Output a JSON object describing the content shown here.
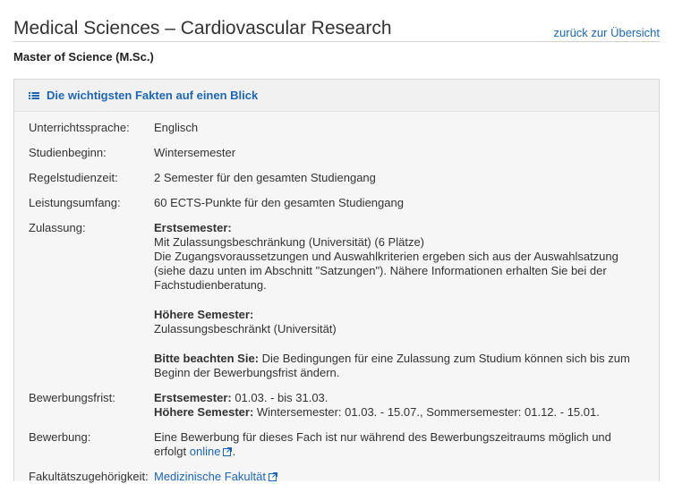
{
  "header": {
    "title": "Medical Sciences – Cardiovascular Research",
    "back_link": "zurück zur Übersicht",
    "degree": "Master of Science (M.Sc.)"
  },
  "panel": {
    "title": "Die wichtigsten Fakten auf einen Blick",
    "icon": "list-icon"
  },
  "facts": {
    "language": {
      "label": "Unterrichtssprache:",
      "value": "Englisch"
    },
    "start": {
      "label": "Studienbeginn:",
      "value": "Wintersemester"
    },
    "duration": {
      "label": "Regelstudienzeit:",
      "value": "2 Semester für den gesamten Studiengang"
    },
    "scope": {
      "label": "Leistungsumfang:",
      "value": "60 ECTS-Punkte für den gesamten Studiengang"
    },
    "admission": {
      "label": "Zulassung:",
      "first_heading": "Erstsemester:",
      "first_line1": "Mit Zulassungsbeschränkung (Universität) (6 Plätze)",
      "first_line2": "Die Zugangsvoraussetzungen und Auswahlkriterien ergeben sich aus der Auswahlsatzung (siehe dazu unten im Abschnitt \"Satzungen\"). Nähere Informationen erhalten Sie bei der Fachstudienberatung.",
      "higher_heading": "Höhere Semester:",
      "higher_text": "Zulassungsbeschränkt (Universität)",
      "note_heading": "Bitte beachten Sie:",
      "note_text": " Die Bedingungen für eine Zulassung zum Studium können sich bis zum Beginn der Bewerbungsfrist ändern."
    },
    "deadline": {
      "label": "Bewerbungsfrist:",
      "first_heading": "Erstsemester:",
      "first_text": " 01.03. - bis 31.03.",
      "higher_heading": "Höhere Semester:",
      "higher_text": " Wintersemester: 01.03. - 15.07., Sommersemester: 01.12. - 15.01."
    },
    "application": {
      "label": "Bewerbung:",
      "text": "Eine Bewerbung für dieses Fach ist nur während des Bewerbungszeitraums möglich und erfolgt ",
      "link": "online",
      "end": "."
    },
    "faculty": {
      "label": "Fakultätszugehörigkeit:",
      "link": "Medizinische Fakultät"
    }
  },
  "colors": {
    "link": "#1f66b0",
    "panel_bg": "#f6f6f6",
    "border": "#d8d8d8"
  }
}
